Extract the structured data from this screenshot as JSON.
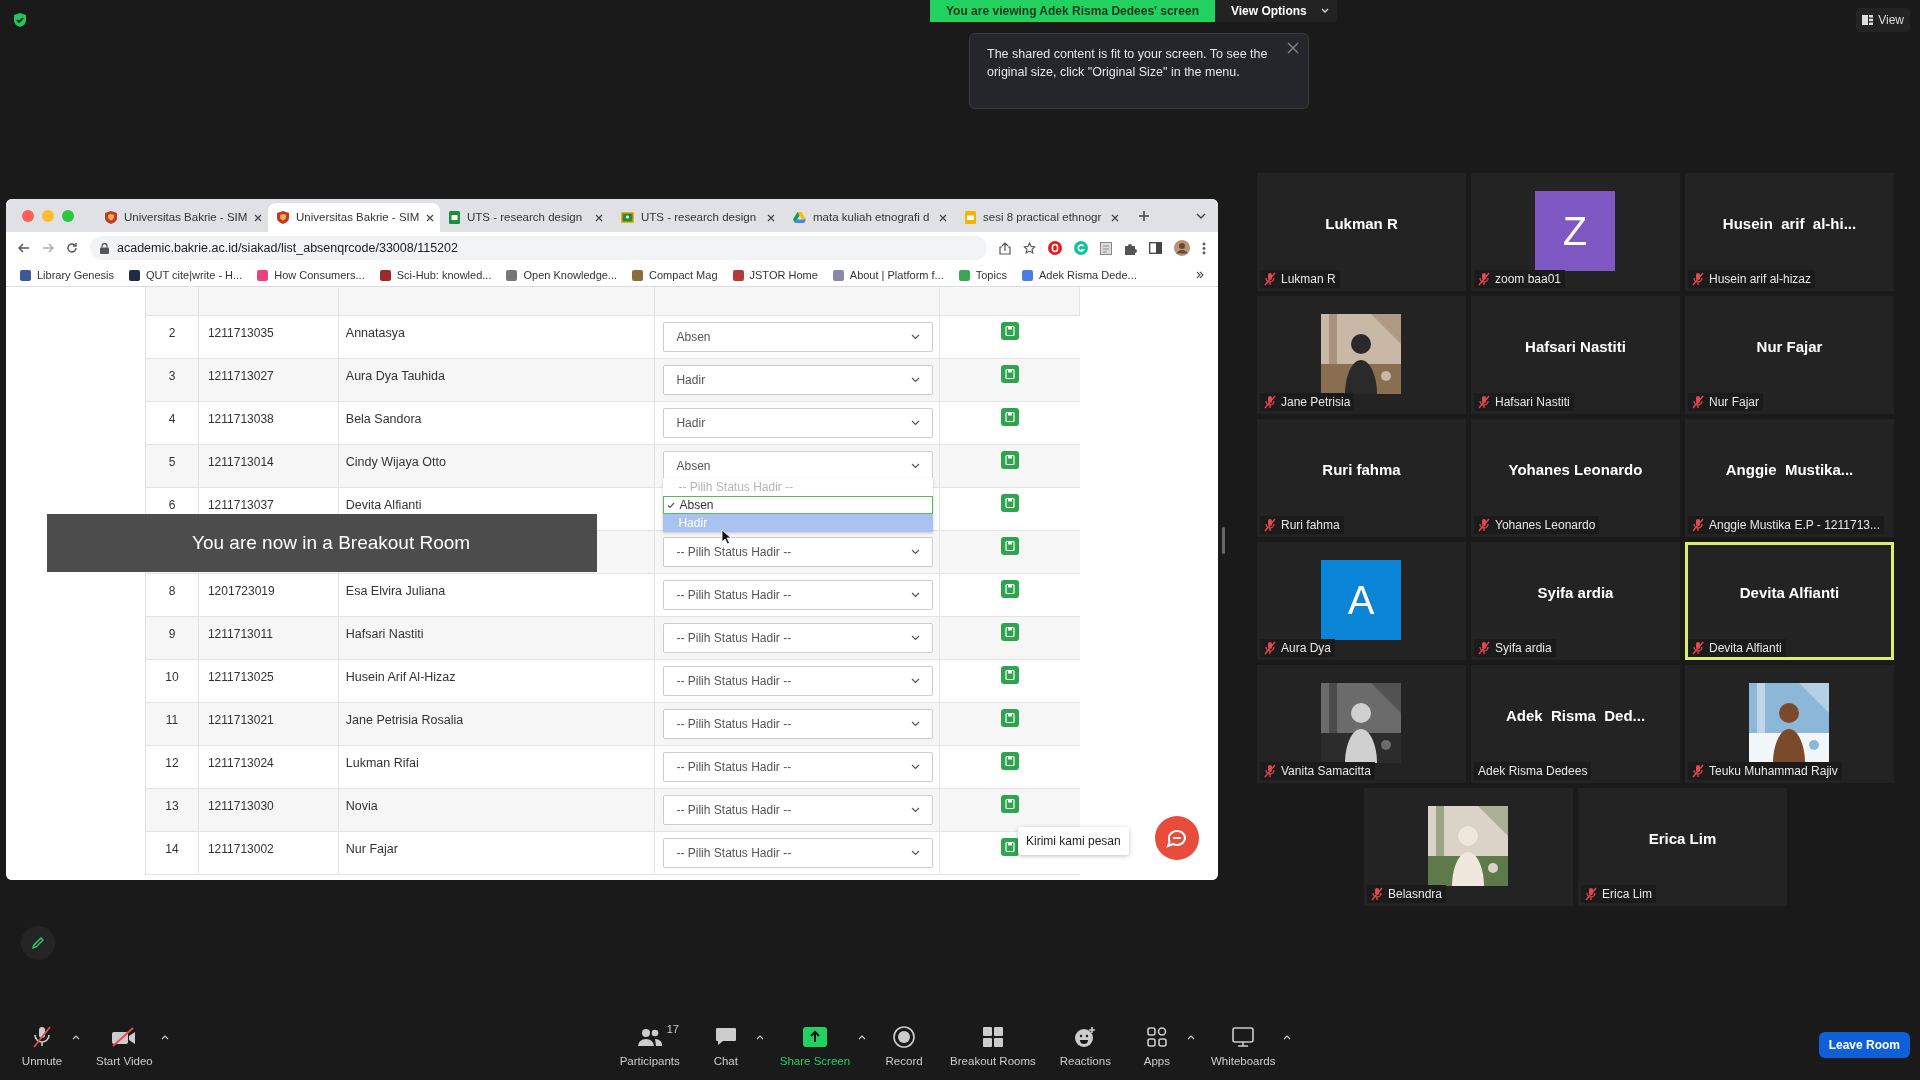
{
  "share_banner": {
    "text": "You are viewing Adek Risma Dedees' screen",
    "view_options": "View Options"
  },
  "fit_tooltip": {
    "text": "The shared content is fit to your screen. To see the original size, click \"Original Size\" in the menu."
  },
  "view_button": "View",
  "breakout_notice": "You are now in a Breakout Room",
  "browser": {
    "tabs": [
      {
        "title": "Universitas Bakrie - SIM",
        "kind": "shield",
        "selected": false
      },
      {
        "title": "Universitas Bakrie - SIM",
        "kind": "shield",
        "selected": true
      },
      {
        "title": "UTS - research design",
        "kind": "sheet",
        "selected": false
      },
      {
        "title": "UTS - research design",
        "kind": "classroom",
        "selected": false
      },
      {
        "title": "mata kuliah etnografi d",
        "kind": "drive",
        "selected": false
      },
      {
        "title": "sesi 8 practical ethnogr",
        "kind": "slides",
        "selected": false
      }
    ],
    "url": "academic.bakrie.ac.id/siakad/list_absenqrcode/33008/115202",
    "bookmarks": [
      {
        "label": "Library Genesis",
        "color": "#3b5998"
      },
      {
        "label": "QUT cite|write - H...",
        "color": "#1f2a44"
      },
      {
        "label": "How Consumers...",
        "color": "#e8447a"
      },
      {
        "label": "Sci-Hub: knowled...",
        "color": "#9b2c2c"
      },
      {
        "label": "Open Knowledge...",
        "color": "#777777"
      },
      {
        "label": "Compact Mag",
        "color": "#8a6d3b"
      },
      {
        "label": "JSTOR Home",
        "color": "#b33a3a"
      },
      {
        "label": "About | Platform f...",
        "color": "#8888aa"
      },
      {
        "label": "Topics",
        "color": "#3aa757"
      },
      {
        "label": "Adek Risma Dede...",
        "color": "#4a7de0"
      }
    ]
  },
  "attendance": {
    "rows": [
      {
        "no": "2",
        "nim": "1211713035",
        "name": "Annatasya",
        "status": "Absen"
      },
      {
        "no": "3",
        "nim": "1211713027",
        "name": "Aura Dya Tauhida",
        "status": "Hadir"
      },
      {
        "no": "4",
        "nim": "1211713038",
        "name": "Bela Sandora",
        "status": "Hadir"
      },
      {
        "no": "5",
        "nim": "1211713014",
        "name": "Cindy Wijaya Otto",
        "status": "Absen"
      },
      {
        "no": "6",
        "nim": "1211713037",
        "name": "Devita Alfianti",
        "options": [
          {
            "label": "-- Pilih Status Hadir --",
            "disabled": true,
            "selected": false,
            "highlighted": false
          },
          {
            "label": "Absen",
            "disabled": false,
            "selected": true,
            "highlighted": false
          },
          {
            "label": "Hadir",
            "disabled": false,
            "selected": false,
            "highlighted": true
          }
        ]
      },
      {
        "status": "-- Pilih Status Hadir --"
      },
      {
        "no": "8",
        "nim": "1201723019",
        "name": "Esa Elvira Juliana",
        "status": "-- Pilih Status Hadir --"
      },
      {
        "no": "9",
        "nim": "1211713011",
        "name": "Hafsari Nastiti",
        "status": "-- Pilih Status Hadir --"
      },
      {
        "no": "10",
        "nim": "1211713025",
        "name": "Husein Arif Al-Hizaz",
        "status": "-- Pilih Status Hadir --"
      },
      {
        "no": "11",
        "nim": "1211713021",
        "name": "Jane Petrisia Rosalia",
        "status": "-- Pilih Status Hadir --"
      },
      {
        "no": "12",
        "nim": "1211713024",
        "name": "Lukman Rifai",
        "status": "-- Pilih Status Hadir --"
      },
      {
        "no": "13",
        "nim": "1211713030",
        "name": "Novia",
        "status": "-- Pilih Status Hadir --"
      },
      {
        "no": "14",
        "nim": "1211713002",
        "name": "Nur Fajar",
        "status": "-- Pilih Status Hadir --"
      }
    ]
  },
  "chat_widget": {
    "label": "Kirimi kami pesan"
  },
  "gallery": [
    {
      "kind": "name",
      "display": "Lukman R",
      "label": "Lukman R",
      "muted": true,
      "active": false
    },
    {
      "kind": "letter",
      "display": "Z",
      "color": "#7e57c2",
      "label": "zoom baa01",
      "muted": true,
      "active": false
    },
    {
      "kind": "name",
      "display": "Husein  arif  al-hi...",
      "label": "Husein arif al-hizaz",
      "muted": true,
      "active": false
    },
    {
      "kind": "picture",
      "label": "Jane Petrisia",
      "muted": true,
      "active": false
    },
    {
      "kind": "name",
      "display": "Hafsari Nastiti",
      "label": "Hafsari Nastiti",
      "muted": true,
      "active": false
    },
    {
      "kind": "name",
      "display": "Nur Fajar",
      "label": "Nur Fajar",
      "muted": true,
      "active": false
    },
    {
      "kind": "name",
      "display": "Ruri fahma",
      "label": "Ruri fahma",
      "muted": true,
      "active": false
    },
    {
      "kind": "name",
      "display": "Yohanes Leonardo",
      "label": "Yohanes Leonardo",
      "muted": true,
      "active": false
    },
    {
      "kind": "name",
      "display": "Anggie  Mustika...",
      "label": "Anggie Mustika E.P - 1211713...",
      "muted": true,
      "active": false
    },
    {
      "kind": "letter",
      "display": "A",
      "color": "#0a84d6",
      "label": "Aura Dya",
      "muted": true,
      "active": false
    },
    {
      "kind": "name",
      "display": "Syifa ardia",
      "label": "Syifa ardia",
      "muted": true,
      "active": false
    },
    {
      "kind": "name",
      "display": "Devita Alfianti",
      "label": "Devita Alfianti",
      "muted": true,
      "active": true
    },
    {
      "kind": "picture",
      "label": "Vanita Samacitta",
      "muted": true,
      "active": false
    },
    {
      "kind": "name",
      "display": "Adek  Risma  Ded...",
      "label": "Adek Risma Dedees",
      "muted": false,
      "active": false
    },
    {
      "kind": "picture",
      "label": "Teuku Muhammad Rajiv",
      "muted": true,
      "active": false
    },
    {
      "kind": "picture",
      "label": "Belasndra",
      "muted": true,
      "active": false
    },
    {
      "kind": "name",
      "display": "Erica Lim",
      "label": "Erica Lim",
      "muted": true,
      "active": false
    }
  ],
  "toolbar": {
    "left": [
      {
        "kind": "mic",
        "label": "Unmute",
        "caret": true
      },
      {
        "kind": "video",
        "label": "Start Video",
        "caret": true
      }
    ],
    "center": [
      {
        "kind": "participants",
        "label": "Participants",
        "count": "17",
        "caret": false
      },
      {
        "kind": "chat",
        "label": "Chat",
        "caret": true
      },
      {
        "kind": "share",
        "label": "Share Screen",
        "caret": true
      },
      {
        "kind": "record",
        "label": "Record",
        "caret": false
      },
      {
        "kind": "breakout",
        "label": "Breakout Rooms",
        "caret": false
      },
      {
        "kind": "reactions",
        "label": "Reactions",
        "caret": false
      },
      {
        "kind": "apps",
        "label": "Apps",
        "caret": true
      },
      {
        "kind": "whiteboards",
        "label": "Whiteboards",
        "caret": true
      }
    ],
    "leave": "Leave Room"
  }
}
